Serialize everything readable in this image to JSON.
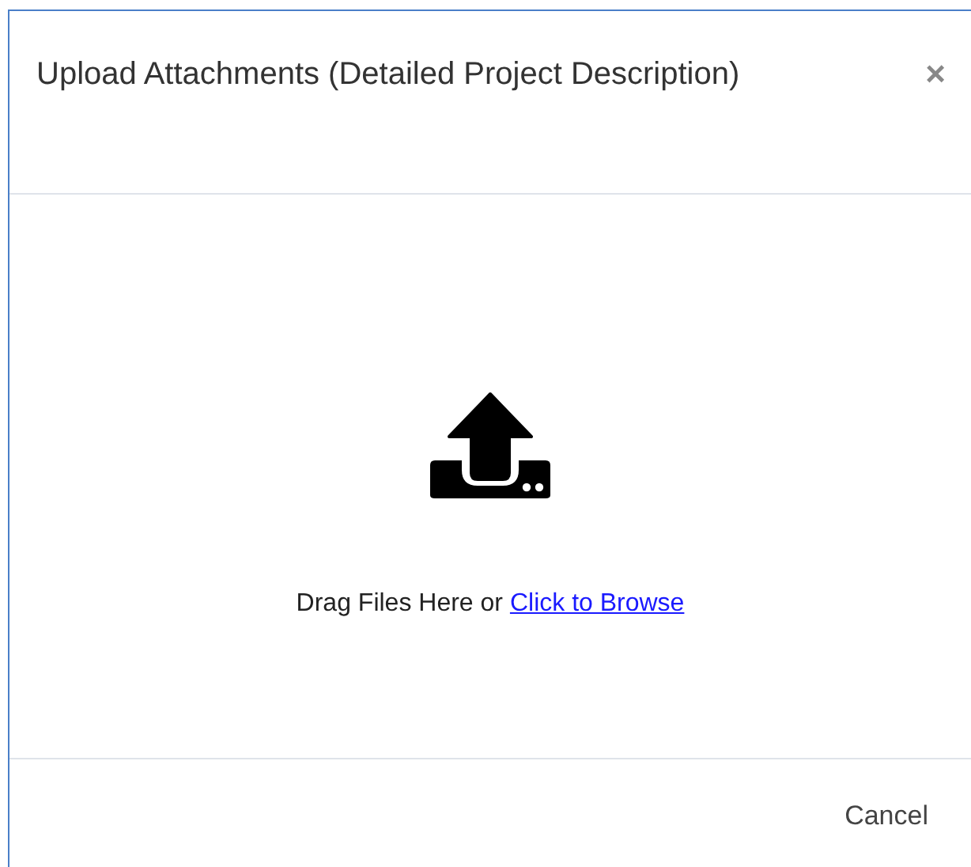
{
  "dialog": {
    "title": "Upload Attachments (Detailed Project Description)",
    "close": "×"
  },
  "dropzone": {
    "text": "Drag Files Here or ",
    "link": "Click to Browse"
  },
  "buttons": [
    "Cancel"
  ]
}
